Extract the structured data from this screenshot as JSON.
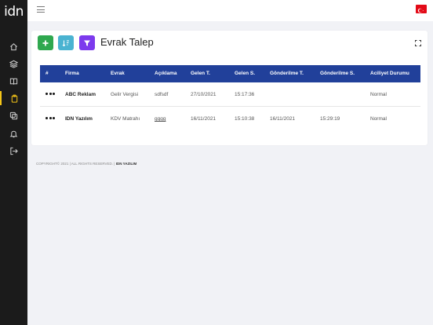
{
  "app": {
    "logo": "idn"
  },
  "sidebar": {
    "items": [
      {
        "icon": "home-icon"
      },
      {
        "icon": "layers-icon"
      },
      {
        "icon": "book-icon"
      },
      {
        "icon": "clipboard-icon",
        "active": true
      },
      {
        "icon": "copy-icon"
      },
      {
        "icon": "bell-icon"
      },
      {
        "icon": "logout-icon"
      }
    ]
  },
  "topbar": {
    "flag": "turkey-flag-icon"
  },
  "page": {
    "title": "Evrak Talep"
  },
  "toolbar": {
    "add_icon": "plus-icon",
    "sort_icon": "sort-icon",
    "filter_icon": "filter-icon"
  },
  "table": {
    "headers": [
      "#",
      "Firma",
      "Evrak",
      "Açıklama",
      "Gelen T.",
      "Gelen S.",
      "Gönderilme T.",
      "Gönderilme S.",
      "Aciliyet Durumu"
    ],
    "rows": [
      {
        "firma": "ABC Reklam",
        "evrak": "Gelir Vergisi",
        "aciklama": "sdfsdf",
        "gelen_t": "27/10/2021",
        "gelen_s": "15:17:36",
        "gonderilme_t": "",
        "gonderilme_s": "",
        "aciliyet": "Normal"
      },
      {
        "firma": "IDN Yazılım",
        "evrak": "KDV Matrahı",
        "aciklama": "gggg",
        "gelen_t": "16/11/2021",
        "gelen_s": "15:10:38",
        "gonderilme_t": "16/11/2021",
        "gonderilme_s": "15:29:19",
        "aciliyet": "Normal"
      }
    ]
  },
  "footer": {
    "text": "COPYRIGHT© 2021 | ALL RIGHTS RESERVED. |",
    "brand": "IDN YAZILIM"
  },
  "colors": {
    "sidebar": "#1b1b1b",
    "table_header": "#21409a",
    "add_button": "#2fa84f",
    "sort_button": "#4ab3d1",
    "filter_button": "#7c3aed",
    "active_accent": "#f5c518"
  }
}
